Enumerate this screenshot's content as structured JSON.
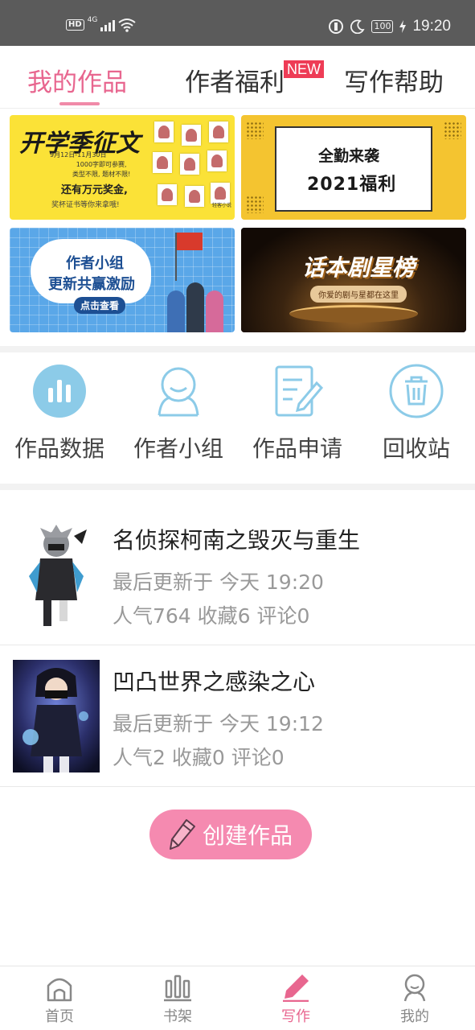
{
  "status_bar": {
    "hd": "HD",
    "network": "4G",
    "battery": "100",
    "time": "19:20"
  },
  "tabs": [
    {
      "label": "我的作品",
      "active": true
    },
    {
      "label": "作者福利",
      "badge": "NEW"
    },
    {
      "label": "写作帮助"
    }
  ],
  "banners": {
    "b1": {
      "title": "开学季征文",
      "date": "9月12日-11月30日",
      "line1": "1000字即可参赛,",
      "line2": "类型不限, 题材不限!",
      "line3": "还有万元奖金,",
      "line4": "奖杯证书等你来拿哦!",
      "corner": "轻客小说"
    },
    "b2": {
      "line1": "全勤来袭",
      "line2": "2021福利"
    },
    "b3": {
      "line1": "作者小组",
      "line2": "更新共赢激励",
      "button": "点击查看"
    },
    "b4": {
      "title": "话本剧星榜",
      "pill": "你爱的剧与星都在这里"
    }
  },
  "actions": [
    {
      "label": "作品数据",
      "icon": "bar-chart-icon"
    },
    {
      "label": "作者小组",
      "icon": "group-icon"
    },
    {
      "label": "作品申请",
      "icon": "edit-document-icon"
    },
    {
      "label": "回收站",
      "icon": "trash-icon"
    }
  ],
  "works": [
    {
      "title": "名侦探柯南之毁灭与重生",
      "updated": "最后更新于 今天 19:20",
      "stats": "人气764 收藏6 评论0"
    },
    {
      "title": "凹凸世界之感染之心",
      "updated": "最后更新于 今天 19:12",
      "stats": "人气2 收藏0 评论0"
    }
  ],
  "create_button": "创建作品",
  "bottom_nav": [
    {
      "label": "首页",
      "icon": "home-icon"
    },
    {
      "label": "书架",
      "icon": "bookshelf-icon"
    },
    {
      "label": "写作",
      "icon": "pen-icon",
      "active": true
    },
    {
      "label": "我的",
      "icon": "profile-icon"
    }
  ],
  "colors": {
    "accent": "#e8668f",
    "icon_blue": "#8ccbe8",
    "create_button": "#f58ab0",
    "badge": "#ee3c56"
  }
}
